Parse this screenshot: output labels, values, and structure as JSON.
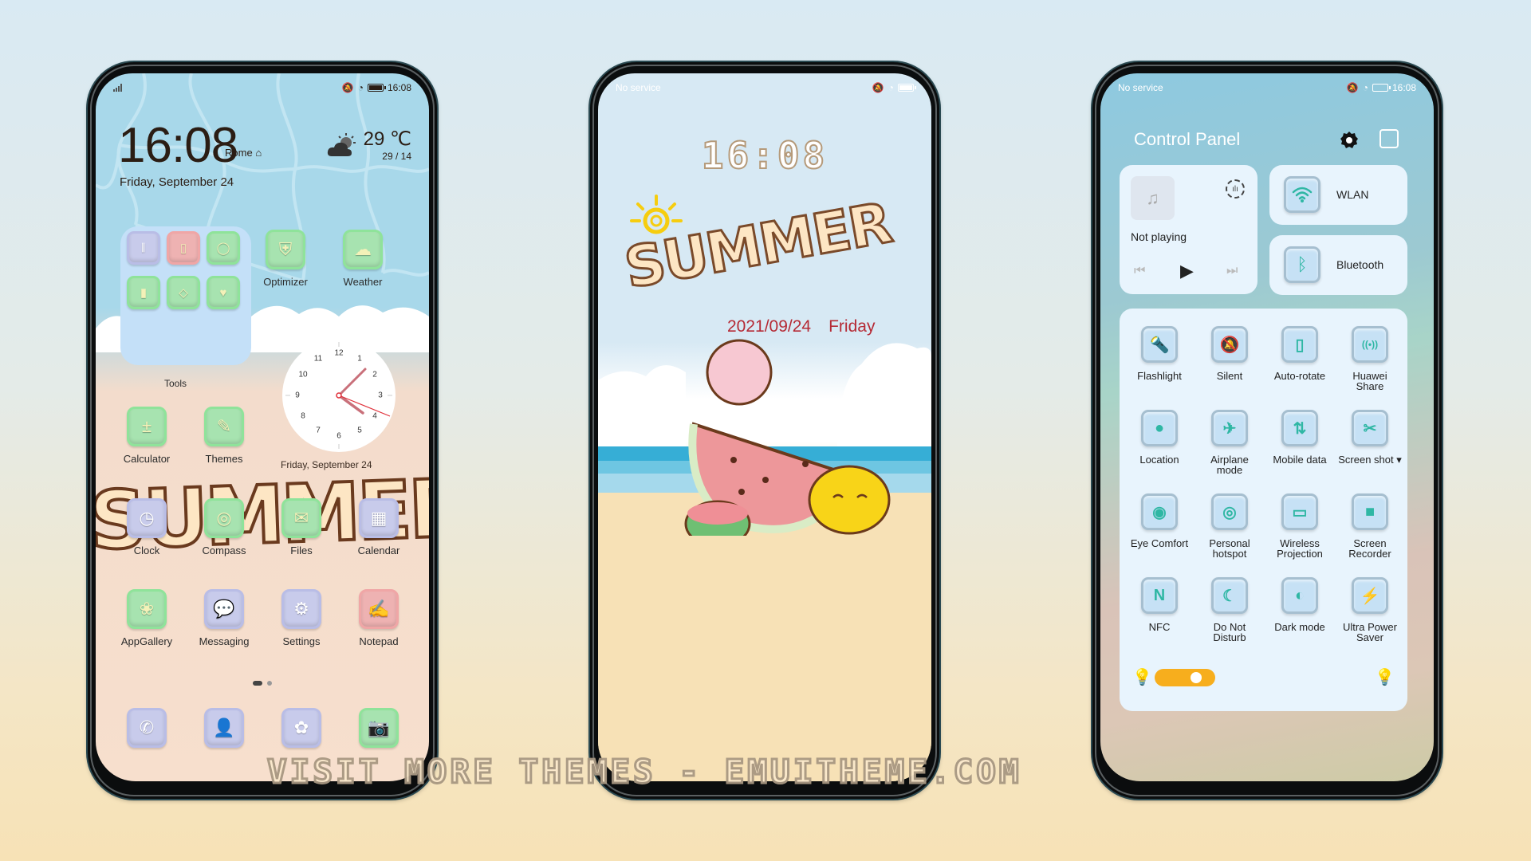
{
  "colors": {
    "accent_slider": "#f7ae1d",
    "lock_date": "#b52a35",
    "qs_icon": "#2fb7a4"
  },
  "home": {
    "status": {
      "time": "16:08",
      "icons": [
        "signal-no-sim",
        "mute-icon",
        "speed-icon",
        "battery-icon"
      ]
    },
    "clock": {
      "time": "16:08",
      "city": "Rome",
      "date": "Friday, September 24"
    },
    "weather": {
      "temp": "29 ℃",
      "range": "29 / 14",
      "icon": "partly-cloudy-icon"
    },
    "folder": {
      "label": "Tools",
      "apps": [
        "recorder-icon",
        "phone-clone-icon",
        "mirror-icon",
        "remote-icon",
        "gem-icon",
        "health-icon"
      ]
    },
    "apps": [
      {
        "label": "Optimizer",
        "icon": "shield-icon",
        "glyph": "⛨"
      },
      {
        "label": "Weather",
        "icon": "cloud-icon",
        "glyph": "☁"
      },
      {
        "label": "Calculator",
        "icon": "calculator-icon",
        "glyph": "±"
      },
      {
        "label": "Themes",
        "icon": "brush-icon",
        "glyph": "✎"
      },
      {
        "label": "Clock",
        "icon": "clock-icon",
        "glyph": "◷"
      },
      {
        "label": "Compass",
        "icon": "compass-icon",
        "glyph": "◎"
      },
      {
        "label": "Files",
        "icon": "envelope-icon",
        "glyph": "✉"
      },
      {
        "label": "Calendar",
        "icon": "calendar-icon",
        "glyph": "▦"
      },
      {
        "label": "AppGallery",
        "icon": "appgallery-icon",
        "glyph": "❀"
      },
      {
        "label": "Messaging",
        "icon": "message-icon",
        "glyph": "💬"
      },
      {
        "label": "Settings",
        "icon": "gear-icon",
        "glyph": "⚙"
      },
      {
        "label": "Notepad",
        "icon": "notepad-icon",
        "glyph": "✍"
      }
    ],
    "analog_clock": {
      "numerals": [
        "12",
        "1",
        "2",
        "3",
        "4",
        "5",
        "6",
        "7",
        "8",
        "9",
        "10",
        "11"
      ],
      "date": "Friday, September 24"
    },
    "wallpaper_text": "SUMMER",
    "page_indicator": {
      "pages": 2,
      "current": 1
    },
    "dock": [
      {
        "icon": "phone-icon",
        "glyph": "✆"
      },
      {
        "icon": "contacts-icon",
        "glyph": "👤"
      },
      {
        "icon": "gallery-icon",
        "glyph": "✿"
      },
      {
        "icon": "camera-icon",
        "glyph": "📷"
      }
    ]
  },
  "lock": {
    "status": {
      "carrier": "No service"
    },
    "time": "16:08",
    "wallpaper_text": "SUMMER",
    "date": "2021/09/24",
    "weekday": "Friday"
  },
  "control": {
    "status": {
      "carrier": "No service",
      "time": "16:08"
    },
    "title": "Control Panel",
    "media": {
      "state": "Not playing"
    },
    "wlan": "WLAN",
    "bluetooth": "Bluetooth",
    "tiles": [
      {
        "label": "Flashlight",
        "icon": "flashlight-icon",
        "glyph": "🔦"
      },
      {
        "label": "Silent",
        "icon": "silent-icon",
        "glyph": "🔕"
      },
      {
        "label": "Auto-rotate",
        "icon": "rotate-icon",
        "glyph": "▯"
      },
      {
        "label": "Huawei Share",
        "icon": "share-icon",
        "glyph": "((•))"
      },
      {
        "label": "Location",
        "icon": "location-icon",
        "glyph": "●"
      },
      {
        "label": "Airplane mode",
        "icon": "airplane-icon",
        "glyph": "✈"
      },
      {
        "label": "Mobile data",
        "icon": "mobile-data-icon",
        "glyph": "⇅"
      },
      {
        "label": "Screen shot ▾",
        "icon": "screenshot-icon",
        "glyph": "✂"
      },
      {
        "label": "Eye Comfort",
        "icon": "eye-icon",
        "glyph": "◉"
      },
      {
        "label": "Personal hotspot",
        "icon": "hotspot-icon",
        "glyph": "◎"
      },
      {
        "label": "Wireless Projection",
        "icon": "projection-icon",
        "glyph": "▭"
      },
      {
        "label": "Screen Recorder",
        "icon": "recorder-icon",
        "glyph": "■"
      },
      {
        "label": "NFC",
        "icon": "nfc-icon",
        "glyph": "N"
      },
      {
        "label": "Do Not Disturb",
        "icon": "moon-icon",
        "glyph": "☾"
      },
      {
        "label": "Dark mode",
        "icon": "dark-mode-icon",
        "glyph": "◐"
      },
      {
        "label": "Ultra Power Saver",
        "icon": "power-saver-icon",
        "glyph": "⚡"
      }
    ],
    "brightness": 0.75
  },
  "watermark": "VISIT MORE THEMES - EMUITHEME.COM"
}
